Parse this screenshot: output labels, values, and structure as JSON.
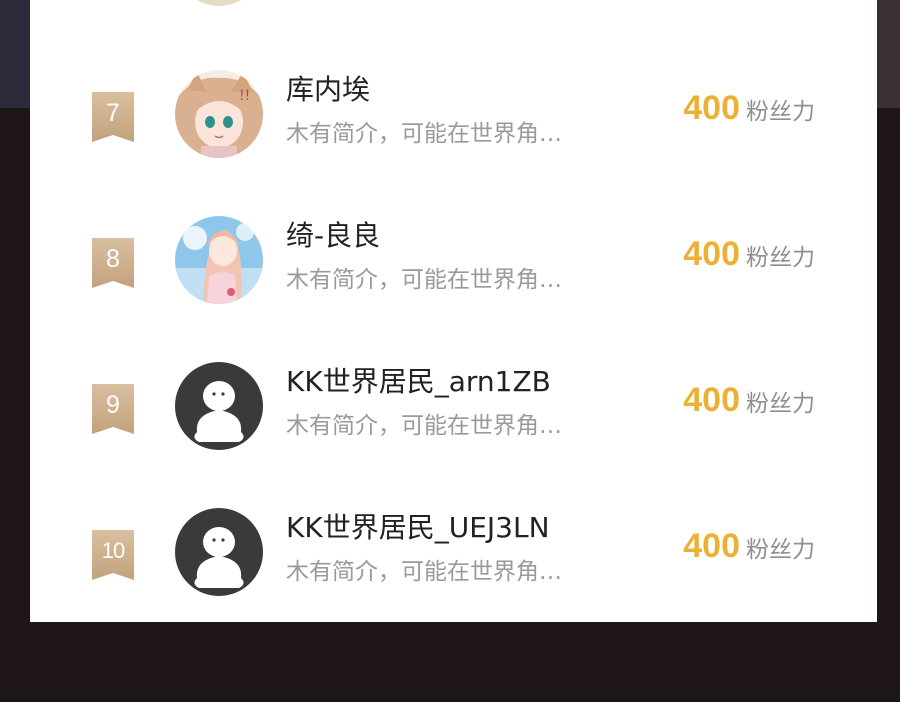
{
  "leaderboard": {
    "rows": [
      {
        "rank": "7",
        "name": "库内埃",
        "bio": "木有简介，可能在世界角…",
        "score": "400",
        "unit": "粉丝力",
        "avatar": "anime-catgirl-avatar"
      },
      {
        "rank": "8",
        "name": "绮-良良",
        "bio": "木有简介，可能在世界角…",
        "score": "400",
        "unit": "粉丝力",
        "avatar": "anime-girl-beach-avatar"
      },
      {
        "rank": "9",
        "name": "KK世界居民_arn1ZB",
        "bio": "木有简介，可能在世界角…",
        "score": "400",
        "unit": "粉丝力",
        "avatar": "default-person-avatar"
      },
      {
        "rank": "10",
        "name": "KK世界居民_UEJ3LN",
        "bio": "木有简介，可能在世界角…",
        "score": "400",
        "unit": "粉丝力",
        "avatar": "default-person-avatar"
      }
    ]
  },
  "colors": {
    "score": "#ebb034",
    "badge": "#c9aa86",
    "panel": "#ffffff",
    "backdrop": "#1e1616"
  }
}
